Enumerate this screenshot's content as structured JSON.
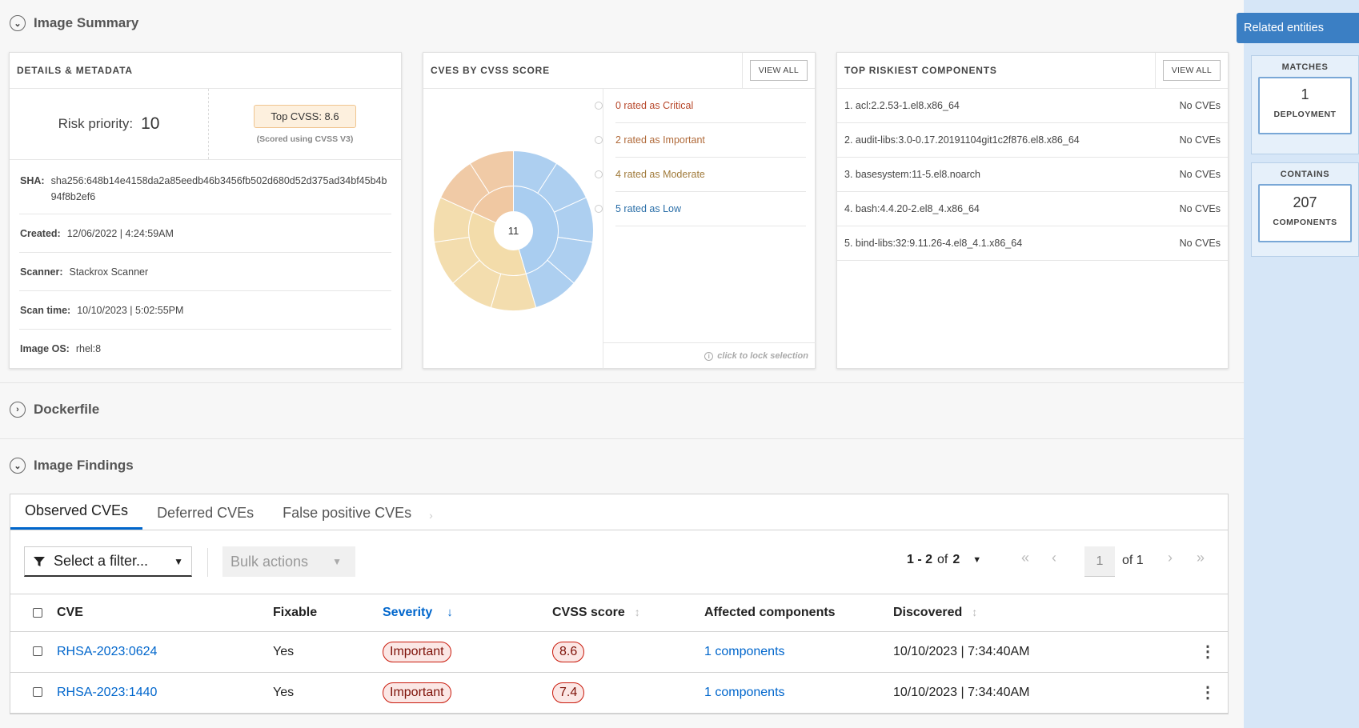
{
  "sections": {
    "summary_title": "Image Summary",
    "dockerfile_title": "Dockerfile",
    "findings_title": "Image Findings"
  },
  "details": {
    "title": "DETAILS & METADATA",
    "risk_label": "Risk priority:",
    "risk_value": "10",
    "top_cvss": "Top CVSS: 8.6",
    "cvss_note": "(Scored using CVSS V3)",
    "rows": [
      {
        "key": "SHA:",
        "value": "sha256:648b14e4158da2a85eedb46b3456fb502d680d52d375ad34bf45b4b94f8b2ef6"
      },
      {
        "key": "Created:",
        "value": "12/06/2022 | 4:24:59AM"
      },
      {
        "key": "Scanner:",
        "value": "Stackrox Scanner"
      },
      {
        "key": "Scan time:",
        "value": "10/10/2023 | 5:02:55PM"
      },
      {
        "key": "Image OS:",
        "value": "rhel:8"
      }
    ]
  },
  "cves_card": {
    "title": "CVES BY CVSS SCORE",
    "view_all": "VIEW ALL",
    "center_count": "11",
    "legend": [
      {
        "label": "0 rated as Critical",
        "color": "#b7472a"
      },
      {
        "label": "2 rated as Important",
        "color": "#b06a3a"
      },
      {
        "label": "4 rated as Moderate",
        "color": "#a07a3a"
      },
      {
        "label": "5 rated as Low",
        "color": "#2b6fa8"
      }
    ],
    "hint": "click to lock selection",
    "colors": {
      "important": "#f0c8a2",
      "moderate": "#f3dcaa",
      "low": "#a9cdf0"
    }
  },
  "components_card": {
    "title": "TOP RISKIEST COMPONENTS",
    "view_all": "VIEW ALL",
    "items": [
      {
        "name": "1. acl:2.2.53-1.el8.x86_64",
        "cves": "No CVEs"
      },
      {
        "name": "2. audit-libs:3.0-0.17.20191104git1c2f876.el8.x86_64",
        "cves": "No CVEs"
      },
      {
        "name": "3. basesystem:11-5.el8.noarch",
        "cves": "No CVEs"
      },
      {
        "name": "4. bash:4.4.20-2.el8_4.x86_64",
        "cves": "No CVEs"
      },
      {
        "name": "5. bind-libs:32:9.11.26-4.el8_4.1.x86_64",
        "cves": "No CVEs"
      }
    ]
  },
  "findings": {
    "tabs": [
      "Observed CVEs",
      "Deferred CVEs",
      "False positive CVEs"
    ],
    "filter_label": "Select a filter...",
    "bulk_label": "Bulk actions",
    "pager_range": "1 - 2",
    "pager_of": "of",
    "pager_total": "2",
    "page_value": "1",
    "page_of": "of 1",
    "columns": {
      "cve": "CVE",
      "fixable": "Fixable",
      "severity": "Severity",
      "cvss": "CVSS score",
      "affected": "Affected components",
      "discovered": "Discovered"
    },
    "rows": [
      {
        "cve": "RHSA-2023:0624",
        "fixable": "Yes",
        "severity": "Important",
        "cvss": "8.6",
        "affected": "1 components",
        "discovered": "10/10/2023 | 7:34:40AM"
      },
      {
        "cve": "RHSA-2023:1440",
        "fixable": "Yes",
        "severity": "Important",
        "cvss": "7.4",
        "affected": "1 components",
        "discovered": "10/10/2023 | 7:34:40AM"
      }
    ]
  },
  "sidebar": {
    "related_label": "Related entities",
    "matches_title": "MATCHES",
    "matches_count": "1",
    "matches_label": "DEPLOYMENT",
    "contains_title": "CONTAINS",
    "contains_count": "207",
    "contains_label": "COMPONENTS"
  }
}
